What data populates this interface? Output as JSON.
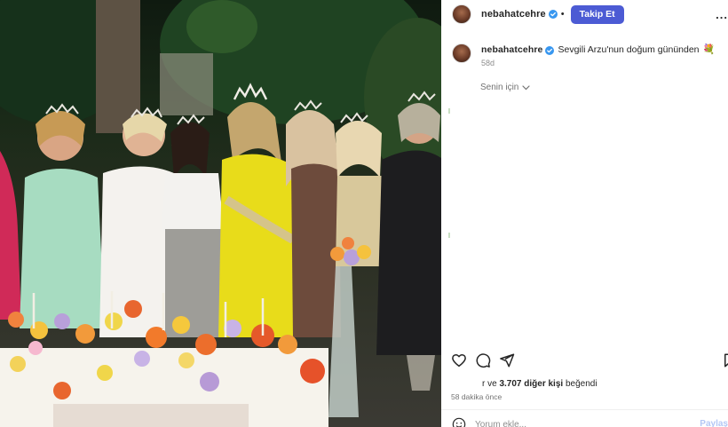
{
  "post": {
    "username": "nebahatcehre",
    "dot": "•",
    "follow_label": "Takip Et",
    "more_label": "..."
  },
  "caption": {
    "username": "nebahatcehre",
    "text": "Sevgili Arzu'nun doğum gününden",
    "emoji": "💐",
    "age": "58d"
  },
  "for_you": {
    "label": "Senin için"
  },
  "likes": {
    "prefix": "r ve ",
    "count": "3.707 diğer kişi",
    "suffix": " beğendi"
  },
  "timestamp": "58 dakika önce",
  "comment": {
    "placeholder": "Yorum ekle...",
    "share_label": "Paylaş"
  },
  "colors": {
    "follow_button": "#4c5bd4",
    "verified_badge": "#3897f0",
    "text_primary": "#262626",
    "text_secondary": "#737373"
  },
  "icons": {
    "verified": "verified-badge-icon",
    "like": "heart-icon",
    "comment": "comment-bubble-icon",
    "share": "paper-plane-icon",
    "save": "bookmark-icon",
    "emoji": "emoji-face-icon",
    "chevron": "chevron-down-icon"
  }
}
